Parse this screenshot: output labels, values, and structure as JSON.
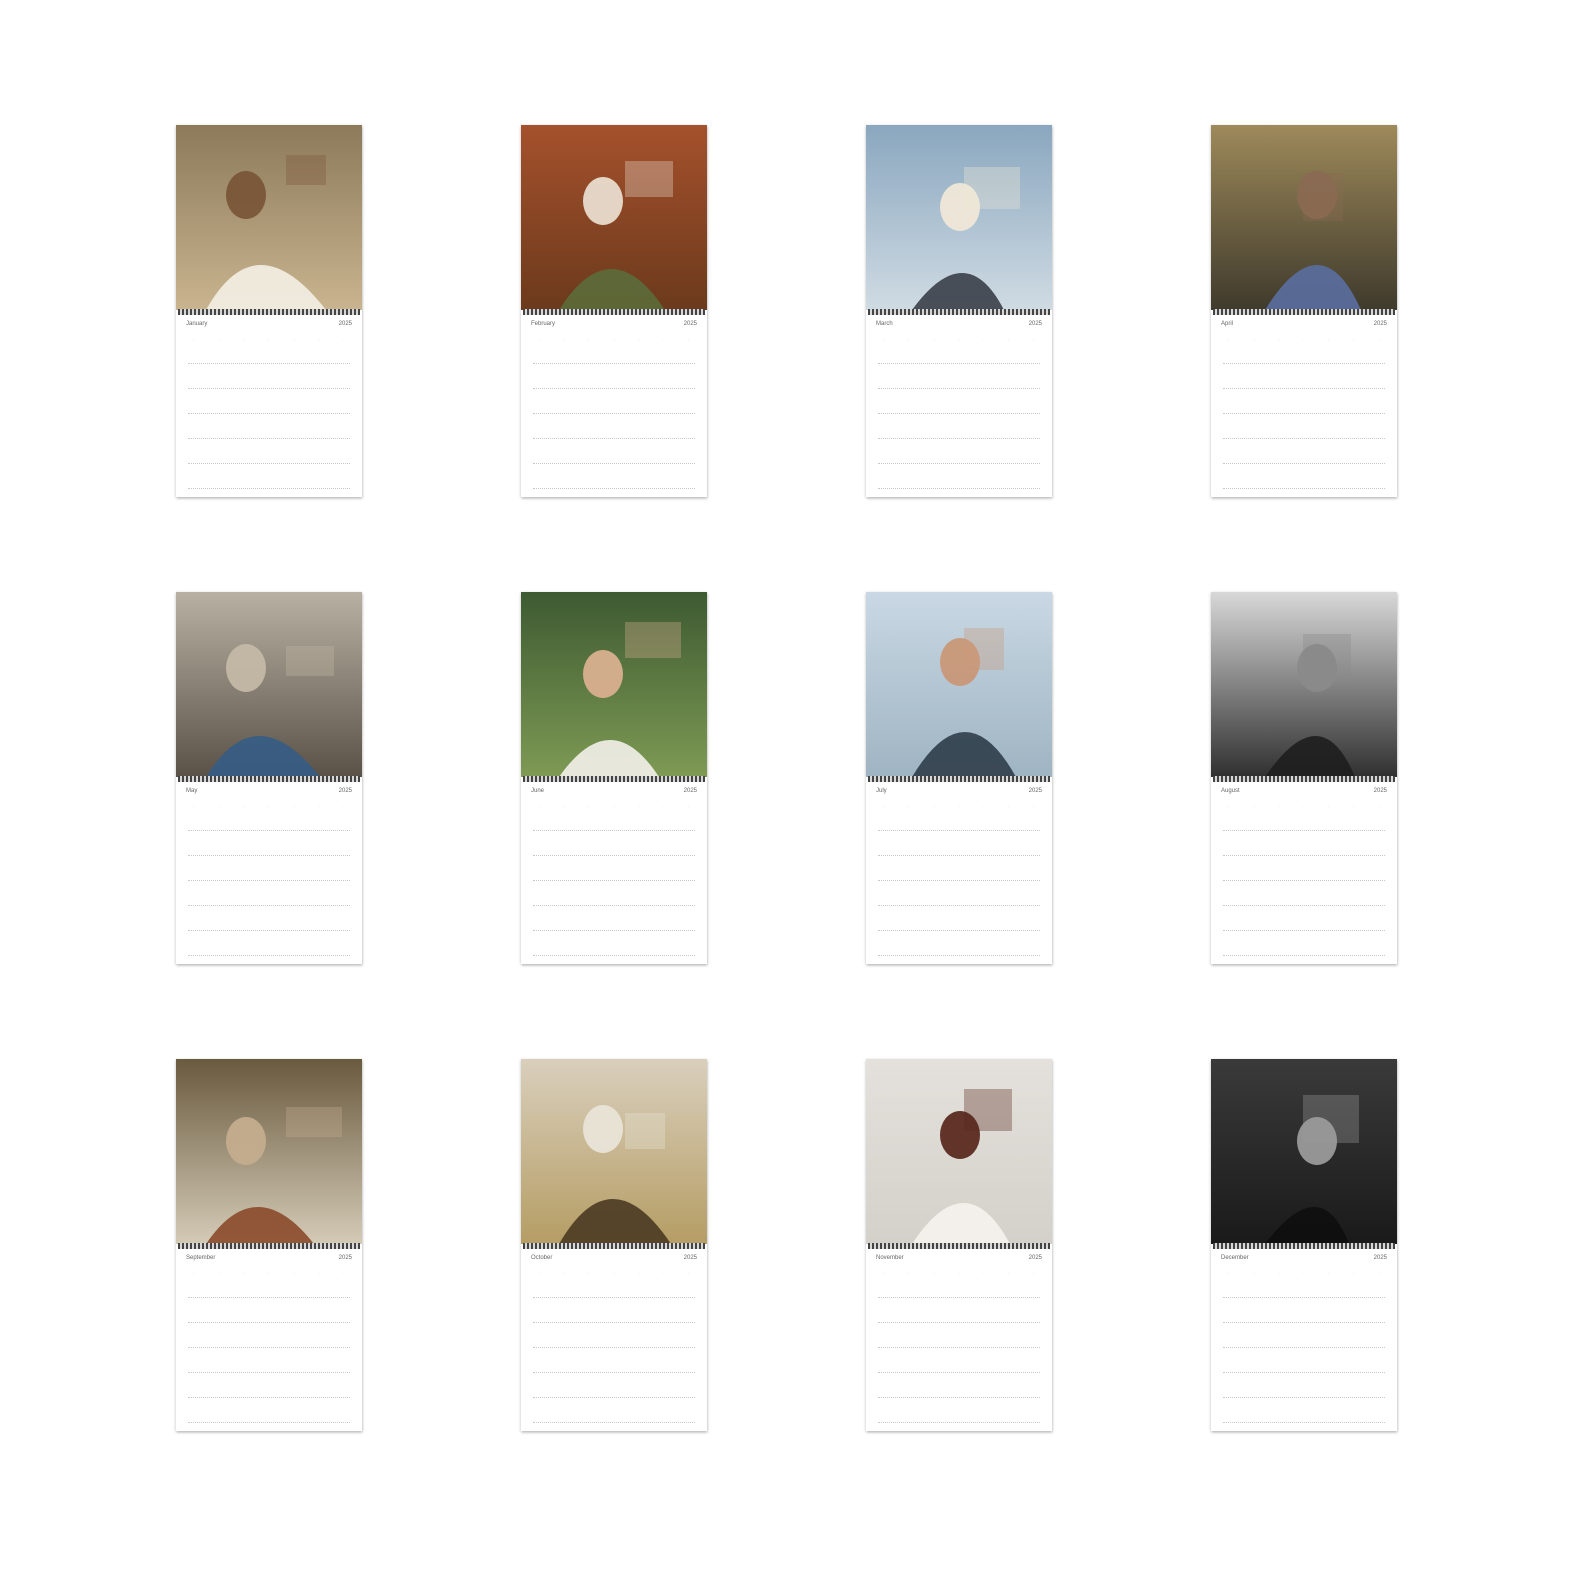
{
  "calendar": {
    "pages": [
      {
        "month": "January",
        "year": "2025",
        "photo_icon": "photo-man-kissing-dog"
      },
      {
        "month": "February",
        "year": "2025",
        "photo_icon": "photo-man-lying-on-rug"
      },
      {
        "month": "March",
        "year": "2025",
        "photo_icon": "photo-man-in-car"
      },
      {
        "month": "April",
        "year": "2025",
        "photo_icon": "photo-man-behind-ironwork"
      },
      {
        "month": "May",
        "year": "2025",
        "photo_icon": "photo-man-sitting-on-floor"
      },
      {
        "month": "June",
        "year": "2025",
        "photo_icon": "photo-man-with-towel-on-head"
      },
      {
        "month": "July",
        "year": "2025",
        "photo_icon": "photo-man-at-pool"
      },
      {
        "month": "August",
        "year": "2025",
        "photo_icon": "photo-man-black-white-portrait"
      },
      {
        "month": "September",
        "year": "2025",
        "photo_icon": "photo-man-in-room"
      },
      {
        "month": "October",
        "year": "2025",
        "photo_icon": "photo-man-in-field"
      },
      {
        "month": "November",
        "year": "2025",
        "photo_icon": "photo-man-in-suit"
      },
      {
        "month": "December",
        "year": "2025",
        "photo_icon": "photo-man-black-white-tuxedo"
      }
    ]
  }
}
